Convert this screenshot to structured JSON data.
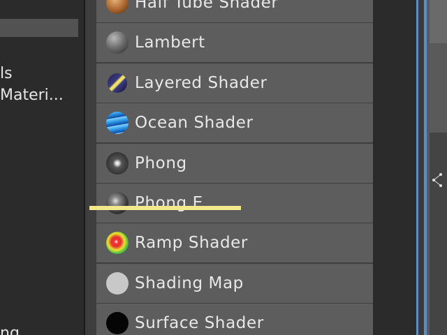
{
  "left_panel": {
    "labels": [
      "ls",
      "Materi...",
      "ng"
    ]
  },
  "shader_list": {
    "items": [
      {
        "label": "Half Tube Shader",
        "icon": "half-tube-shader-icon"
      },
      {
        "label": "Lambert",
        "icon": "lambert-icon"
      },
      {
        "label": "Layered Shader",
        "icon": "layered-shader-icon"
      },
      {
        "label": "Ocean Shader",
        "icon": "ocean-shader-icon"
      },
      {
        "label": "Phong",
        "icon": "phong-icon"
      },
      {
        "label": "Phong E",
        "icon": "phong-e-icon"
      },
      {
        "label": "Ramp Shader",
        "icon": "ramp-shader-icon"
      },
      {
        "label": "Shading Map",
        "icon": "shading-map-icon"
      },
      {
        "label": "Surface Shader",
        "icon": "surface-shader-icon"
      }
    ]
  },
  "colors": {
    "list_item_bg": "#5d5d5d",
    "highlight": "#f4e88c",
    "accent_blue": "#5b8fc4"
  }
}
